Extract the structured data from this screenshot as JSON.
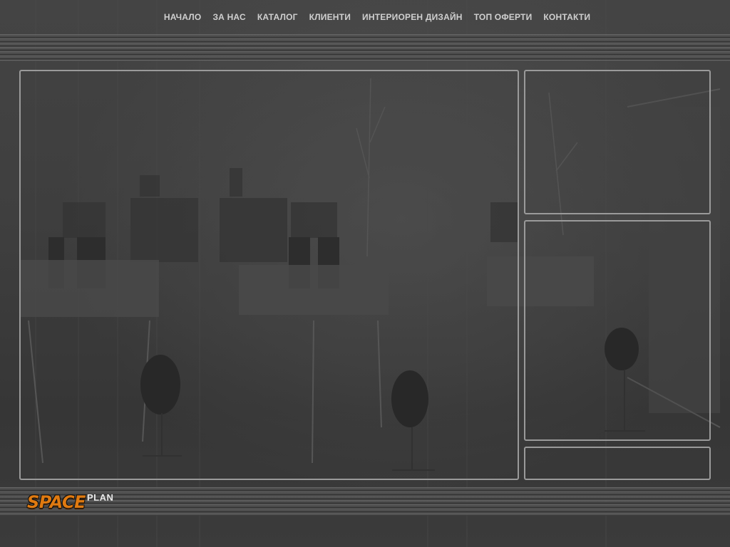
{
  "nav": {
    "items": [
      {
        "label": "НАЧАЛО"
      },
      {
        "label": "ЗА НАС"
      },
      {
        "label": "КАТАЛОГ"
      },
      {
        "label": "КЛИЕНТИ"
      },
      {
        "label": "ИНТЕРИОРЕН ДИЗАЙН"
      },
      {
        "label": "ТОП ОФЕРТИ"
      },
      {
        "label": "КОНТАКТИ"
      }
    ]
  },
  "logo": {
    "primary": "SPACE",
    "secondary": "PLAN",
    "primary_color": "#e07a10",
    "secondary_color": "#e8e8e8"
  },
  "colors": {
    "background": "#3a3a3a",
    "panel_border": "#9a9a9a",
    "nav_text": "#d0d0d0"
  }
}
